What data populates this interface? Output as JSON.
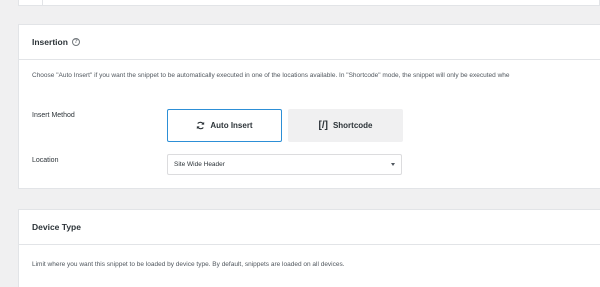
{
  "insertion": {
    "title": "Insertion",
    "help_icon": "question-circle-icon",
    "description": "Choose \"Auto Insert\" if you want the snippet to be automatically executed in one of the locations available. In \"Shortcode\" mode, the snippet will only be executed whe",
    "insert_method_label": "Insert Method",
    "auto_insert": {
      "label": "Auto Insert",
      "icon": "refresh-icon",
      "selected": true
    },
    "shortcode": {
      "label": "Shortcode",
      "icon": "shortcode-icon",
      "icon_text": "[/]",
      "selected": false
    },
    "location_label": "Location",
    "location_value": "Site Wide Header"
  },
  "device_type": {
    "title": "Device Type",
    "description": "Limit where you want this snippet to be loaded by device type. By default, snippets are loaded on all devices."
  },
  "colors": {
    "page_bg": "#f0f0f1",
    "selected_border": "#2d8fd6"
  }
}
